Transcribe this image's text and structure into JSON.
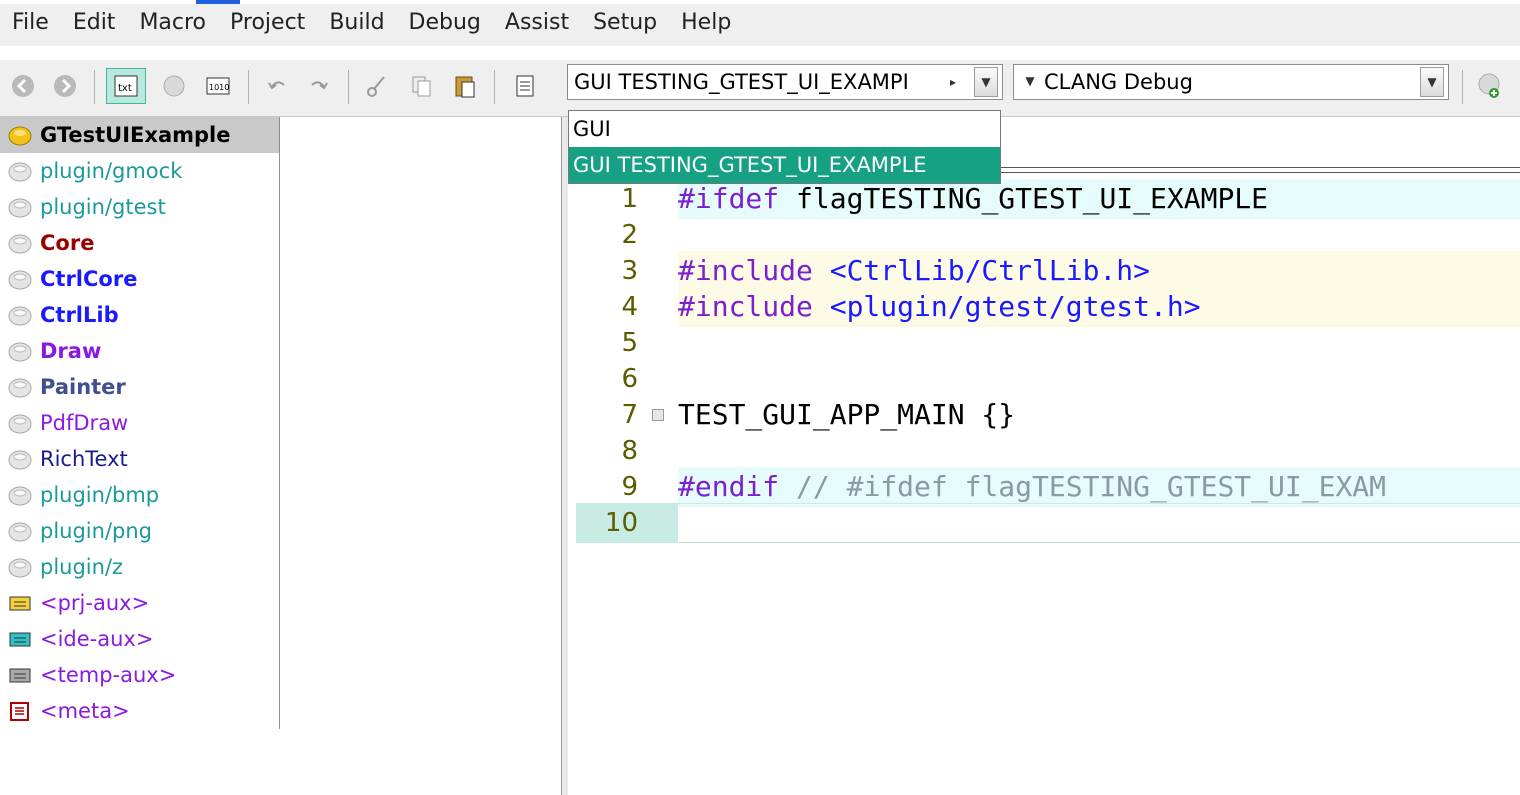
{
  "menu": [
    "File",
    "Edit",
    "Macro",
    "Project",
    "Build",
    "Debug",
    "Assist",
    "Setup",
    "Help"
  ],
  "toolbar": {
    "main_config": "GUI TESTING_GTEST_UI_EXAMPI",
    "build_method": "CLANG Debug"
  },
  "dropdown": {
    "items": [
      "GUI",
      "GUI TESTING_GTEST_UI_EXAMPLE"
    ],
    "selected_index": 1
  },
  "packages": [
    {
      "label": "GTestUIExample",
      "color": "#000000",
      "bold": true,
      "selected": true,
      "icon": "package-main-icon"
    },
    {
      "label": "plugin/gmock",
      "color": "#1a9a9a",
      "bold": false,
      "icon": "package-icon"
    },
    {
      "label": "plugin/gtest",
      "color": "#1a9a9a",
      "bold": false,
      "icon": "package-icon"
    },
    {
      "label": "Core",
      "color": "#9a0000",
      "bold": true,
      "icon": "package-icon"
    },
    {
      "label": "CtrlCore",
      "color": "#1a1aff",
      "bold": true,
      "icon": "package-icon"
    },
    {
      "label": "CtrlLib",
      "color": "#1a1aff",
      "bold": true,
      "icon": "package-icon"
    },
    {
      "label": "Draw",
      "color": "#8a1adf",
      "bold": true,
      "icon": "package-icon"
    },
    {
      "label": "Painter",
      "color": "#3f4f8f",
      "bold": true,
      "icon": "package-icon"
    },
    {
      "label": "PdfDraw",
      "color": "#8a1adf",
      "bold": false,
      "icon": "package-icon"
    },
    {
      "label": "RichText",
      "color": "#1a1a8f",
      "bold": false,
      "icon": "package-icon"
    },
    {
      "label": "plugin/bmp",
      "color": "#1a9a9a",
      "bold": false,
      "icon": "package-icon"
    },
    {
      "label": "plugin/png",
      "color": "#1a9a9a",
      "bold": false,
      "icon": "package-icon"
    },
    {
      "label": "plugin/z",
      "color": "#1a9a9a",
      "bold": false,
      "icon": "package-icon"
    },
    {
      "label": "<prj-aux>",
      "color": "#8a1adf",
      "bold": false,
      "icon": "prj-aux-icon"
    },
    {
      "label": "<ide-aux>",
      "color": "#8a1adf",
      "bold": false,
      "icon": "ide-aux-icon"
    },
    {
      "label": "<temp-aux>",
      "color": "#8a1adf",
      "bold": false,
      "icon": "temp-aux-icon"
    },
    {
      "label": "<meta>",
      "color": "#8a1adf",
      "bold": false,
      "icon": "meta-icon"
    }
  ],
  "editor": {
    "lines": [
      {
        "num": "1",
        "bg": "#e6fcfc",
        "parts": [
          {
            "t": "#ifdef",
            "c": "kw"
          },
          {
            "t": " flagTESTING_GTEST_UI_EXAMPLE",
            "c": ""
          }
        ]
      },
      {
        "num": "2",
        "bg": "#ffffff",
        "parts": []
      },
      {
        "num": "3",
        "bg": "#fdfbe6",
        "parts": [
          {
            "t": "#include",
            "c": "kw"
          },
          {
            "t": " <CtrlLib/CtrlLib.h>",
            "c": "inc"
          }
        ]
      },
      {
        "num": "4",
        "bg": "#fdfbe6",
        "parts": [
          {
            "t": "#include",
            "c": "kw"
          },
          {
            "t": " <plugin/gtest/gtest.h>",
            "c": "inc"
          }
        ]
      },
      {
        "num": "5",
        "bg": "#ffffff",
        "parts": []
      },
      {
        "num": "6",
        "bg": "#ffffff",
        "parts": []
      },
      {
        "num": "7",
        "bg": "#ffffff",
        "fold": true,
        "parts": [
          {
            "t": "TEST_GUI_APP_MAIN {}",
            "c": ""
          }
        ]
      },
      {
        "num": "8",
        "bg": "#ffffff",
        "parts": []
      },
      {
        "num": "9",
        "bg": "#e6fcfc",
        "parts": [
          {
            "t": "#endif",
            "c": "kw"
          },
          {
            "t": " // #ifdef flagTESTING_GTEST_UI_EXAM",
            "c": "cm"
          }
        ]
      },
      {
        "num": "10",
        "bg": "#ffffff",
        "current": true,
        "parts": []
      }
    ]
  }
}
